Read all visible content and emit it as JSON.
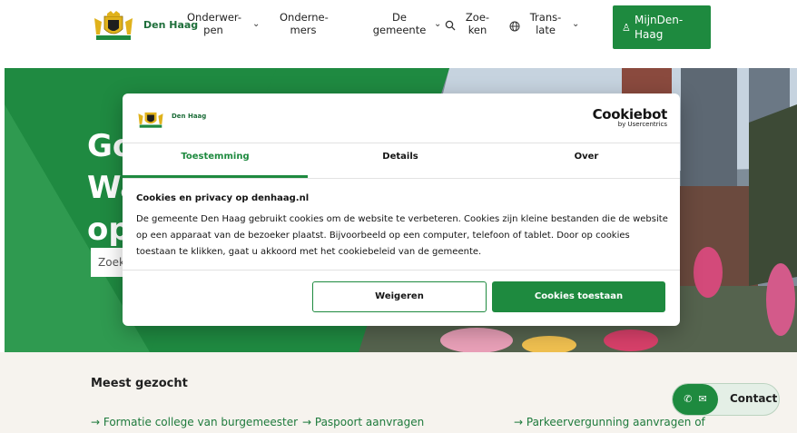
{
  "header": {
    "brand": "Den Haag",
    "nav": [
      {
        "label_line1": "Onderwer-",
        "label_line2": "pen"
      },
      {
        "label_line1": "Onderne-",
        "label_line2": "mers"
      },
      {
        "label_line1": "De",
        "label_line2": "gemeente"
      },
      {
        "label_line1": "Zoe-",
        "label_line2": "ken"
      },
      {
        "label_line1": "Trans-",
        "label_line2": "late"
      }
    ],
    "mijn_line1": "MijnDen-",
    "mijn_line2": "Haag"
  },
  "hero": {
    "title_line1": "Go",
    "title_line2": "Wa",
    "title_line3": "op",
    "search_placeholder": "Zoek"
  },
  "meest_gezocht": {
    "heading": "Meest gezocht",
    "links": [
      "→ Formatie college van burgemeester",
      "→ Paspoort aanvragen",
      "→ Parkeervergunning aanvragen of"
    ]
  },
  "contact": {
    "label": "Contact"
  },
  "cookie_dialog": {
    "brand": "Den Haag",
    "provider": "Cookiebot",
    "provider_sub": "by Usercentrics",
    "tabs": [
      "Toestemming",
      "Details",
      "Over"
    ],
    "active_tab": "Toestemming",
    "heading": "Cookies en privacy op denhaag.nl",
    "body": "De gemeente Den Haag gebruikt cookies om de website te verbeteren. Cookies zijn kleine bestanden die de website op een apparaat van de bezoeker plaatst. Bijvoorbeeld op een computer, telefoon of tablet. Door op cookies toestaan te klikken, gaat u akkoord met het cookiebeleid van de gemeente.",
    "decline_label": "Weigeren",
    "accept_label": "Cookies toestaan"
  },
  "colors": {
    "brand_green": "#1e8a3f",
    "hero_green": "#1f8a41",
    "bottom_bg": "#f6f3ee"
  }
}
